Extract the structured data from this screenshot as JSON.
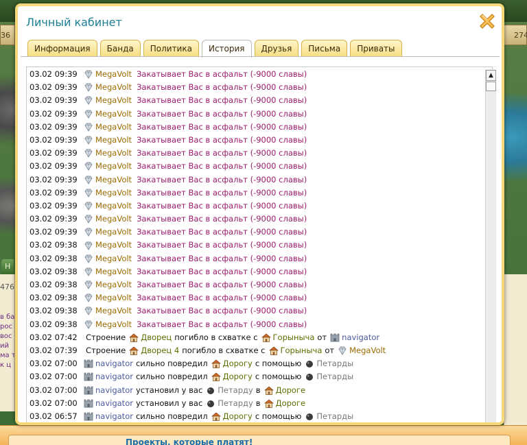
{
  "background": {
    "left_counter": "36",
    "right_counter": "274",
    "left_number": "476",
    "left_tab_label": "Н",
    "left_panel_lines": [
      "в ба",
      "рос",
      "вос",
      "ий",
      "ма т",
      "к  ц"
    ],
    "bottom_banner": "Проекты, которые платят!"
  },
  "modal": {
    "title": "Личный кабинет",
    "close_icon": "close-x-icon",
    "tabs": [
      {
        "label": "Информация",
        "active": false
      },
      {
        "label": "Банда",
        "active": false
      },
      {
        "label": "Политика",
        "active": false
      },
      {
        "label": "История",
        "active": true
      },
      {
        "label": "Друзья",
        "active": false
      },
      {
        "label": "Письма",
        "active": false
      },
      {
        "label": "Приваты",
        "active": false
      }
    ]
  },
  "log": [
    {
      "time": "03.02 09:39",
      "type": "asphalt",
      "user": "MegaVolt",
      "action": "Закатывает Вас в асфальт (-9000 славы)"
    },
    {
      "time": "03.02 09:39",
      "type": "asphalt",
      "user": "MegaVolt",
      "action": "Закатывает Вас в асфальт (-9000 славы)"
    },
    {
      "time": "03.02 09:39",
      "type": "asphalt",
      "user": "MegaVolt",
      "action": "Закатывает Вас в асфальт (-9000 славы)"
    },
    {
      "time": "03.02 09:39",
      "type": "asphalt",
      "user": "MegaVolt",
      "action": "Закатывает Вас в асфальт (-9000 славы)"
    },
    {
      "time": "03.02 09:39",
      "type": "asphalt",
      "user": "MegaVolt",
      "action": "Закатывает Вас в асфальт (-9000 славы)"
    },
    {
      "time": "03.02 09:39",
      "type": "asphalt",
      "user": "MegaVolt",
      "action": "Закатывает Вас в асфальт (-9000 славы)"
    },
    {
      "time": "03.02 09:39",
      "type": "asphalt",
      "user": "MegaVolt",
      "action": "Закатывает Вас в асфальт (-9000 славы)"
    },
    {
      "time": "03.02 09:39",
      "type": "asphalt",
      "user": "MegaVolt",
      "action": "Закатывает Вас в асфальт (-9000 славы)"
    },
    {
      "time": "03.02 09:39",
      "type": "asphalt",
      "user": "MegaVolt",
      "action": "Закатывает Вас в асфальт (-9000 славы)"
    },
    {
      "time": "03.02 09:39",
      "type": "asphalt",
      "user": "MegaVolt",
      "action": "Закатывает Вас в асфальт (-9000 славы)"
    },
    {
      "time": "03.02 09:39",
      "type": "asphalt",
      "user": "MegaVolt",
      "action": "Закатывает Вас в асфальт (-9000 славы)"
    },
    {
      "time": "03.02 09:39",
      "type": "asphalt",
      "user": "MegaVolt",
      "action": "Закатывает Вас в асфальт (-9000 славы)"
    },
    {
      "time": "03.02 09:39",
      "type": "asphalt",
      "user": "MegaVolt",
      "action": "Закатывает Вас в асфальт (-9000 славы)"
    },
    {
      "time": "03.02 09:38",
      "type": "asphalt",
      "user": "MegaVolt",
      "action": "Закатывает Вас в асфальт (-9000 славы)"
    },
    {
      "time": "03.02 09:38",
      "type": "asphalt",
      "user": "MegaVolt",
      "action": "Закатывает Вас в асфальт (-9000 славы)"
    },
    {
      "time": "03.02 09:38",
      "type": "asphalt",
      "user": "MegaVolt",
      "action": "Закатывает Вас в асфальт (-9000 славы)"
    },
    {
      "time": "03.02 09:38",
      "type": "asphalt",
      "user": "MegaVolt",
      "action": "Закатывает Вас в асфальт (-9000 славы)"
    },
    {
      "time": "03.02 09:38",
      "type": "asphalt",
      "user": "MegaVolt",
      "action": "Закатывает Вас в асфальт (-9000 славы)"
    },
    {
      "time": "03.02 09:38",
      "type": "asphalt",
      "user": "MegaVolt",
      "action": "Закатывает Вас в асфальт (-9000 славы)"
    },
    {
      "time": "03.02 09:38",
      "type": "asphalt",
      "user": "MegaVolt",
      "action": "Закатывает Вас в асфальт (-9000 славы)"
    },
    {
      "time": "03.02 07:42",
      "type": "destroyed",
      "prefix": "Строение",
      "building": "Дворец",
      "mid": "погибло в схватке с",
      "enemy": "Горыныча",
      "from": "от",
      "user": "navigator",
      "user_style": "nav"
    },
    {
      "time": "03.02 07:39",
      "type": "destroyed",
      "prefix": "Строение",
      "building": "Дворец 4",
      "mid": "погибло в схватке с",
      "enemy": "Горыныча",
      "from": "от",
      "user": "MegaVolt",
      "user_style": "mega"
    },
    {
      "time": "03.02 07:00",
      "type": "damaged",
      "user": "navigator",
      "verb": "сильно повредил",
      "target": "Дорогу",
      "with": "с помощью",
      "item": "Петарды"
    },
    {
      "time": "03.02 07:00",
      "type": "damaged",
      "user": "navigator",
      "verb": "сильно повредил",
      "target": "Дорогу",
      "with": "с помощью",
      "item": "Петарды"
    },
    {
      "time": "03.02 07:00",
      "type": "installed",
      "user": "navigator",
      "verb": "установил у вас",
      "item": "Петарду",
      "in": "в",
      "target": "Дороге"
    },
    {
      "time": "03.02 07:00",
      "type": "installed",
      "user": "navigator",
      "verb": "установил у вас",
      "item": "Петарду",
      "in": "в",
      "target": "Дороге"
    },
    {
      "time": "03.02 06:57",
      "type": "damaged",
      "user": "navigator",
      "verb": "сильно повредил",
      "target": "Дорогу",
      "with": "с помощью",
      "item": "Петарды"
    }
  ]
}
